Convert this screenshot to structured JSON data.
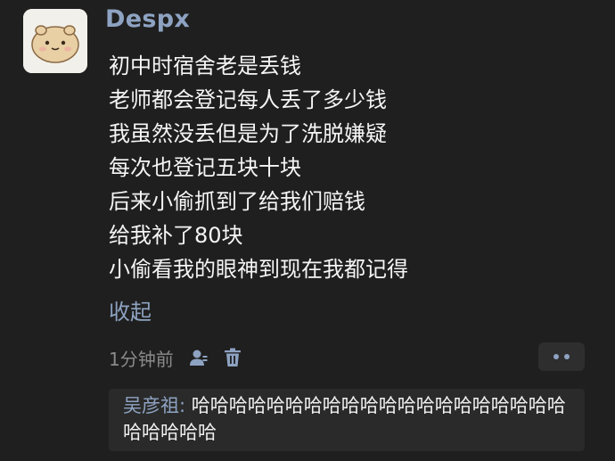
{
  "post": {
    "username": "Despx",
    "lines": [
      "初中时宿舍老是丢钱",
      "老师都会登记每人丢了多少钱",
      "我虽然没丢但是为了洗脱嫌疑",
      "每次也登记五块十块",
      "后来小偷抓到了给我们赔钱",
      "给我补了80块",
      "小偷看我的眼神到现在我都记得"
    ],
    "collapse_label": "收起",
    "timestamp": "1分钟前",
    "avatar_icon": "cartoon-bun-avatar",
    "action_icons": [
      "user-icon",
      "trash-icon",
      "more-dots-icon"
    ]
  },
  "reply": {
    "author": "吴彦祖:",
    "text": " 哈哈哈哈哈哈哈哈哈哈哈哈哈哈哈哈哈哈哈哈哈哈哈哈哈"
  },
  "colors": {
    "background": "#1f1f1f",
    "accent": "#8ea3c2",
    "text": "#f5f5f5",
    "muted": "#8a8a8a",
    "reply_background": "#2a2a2a"
  }
}
